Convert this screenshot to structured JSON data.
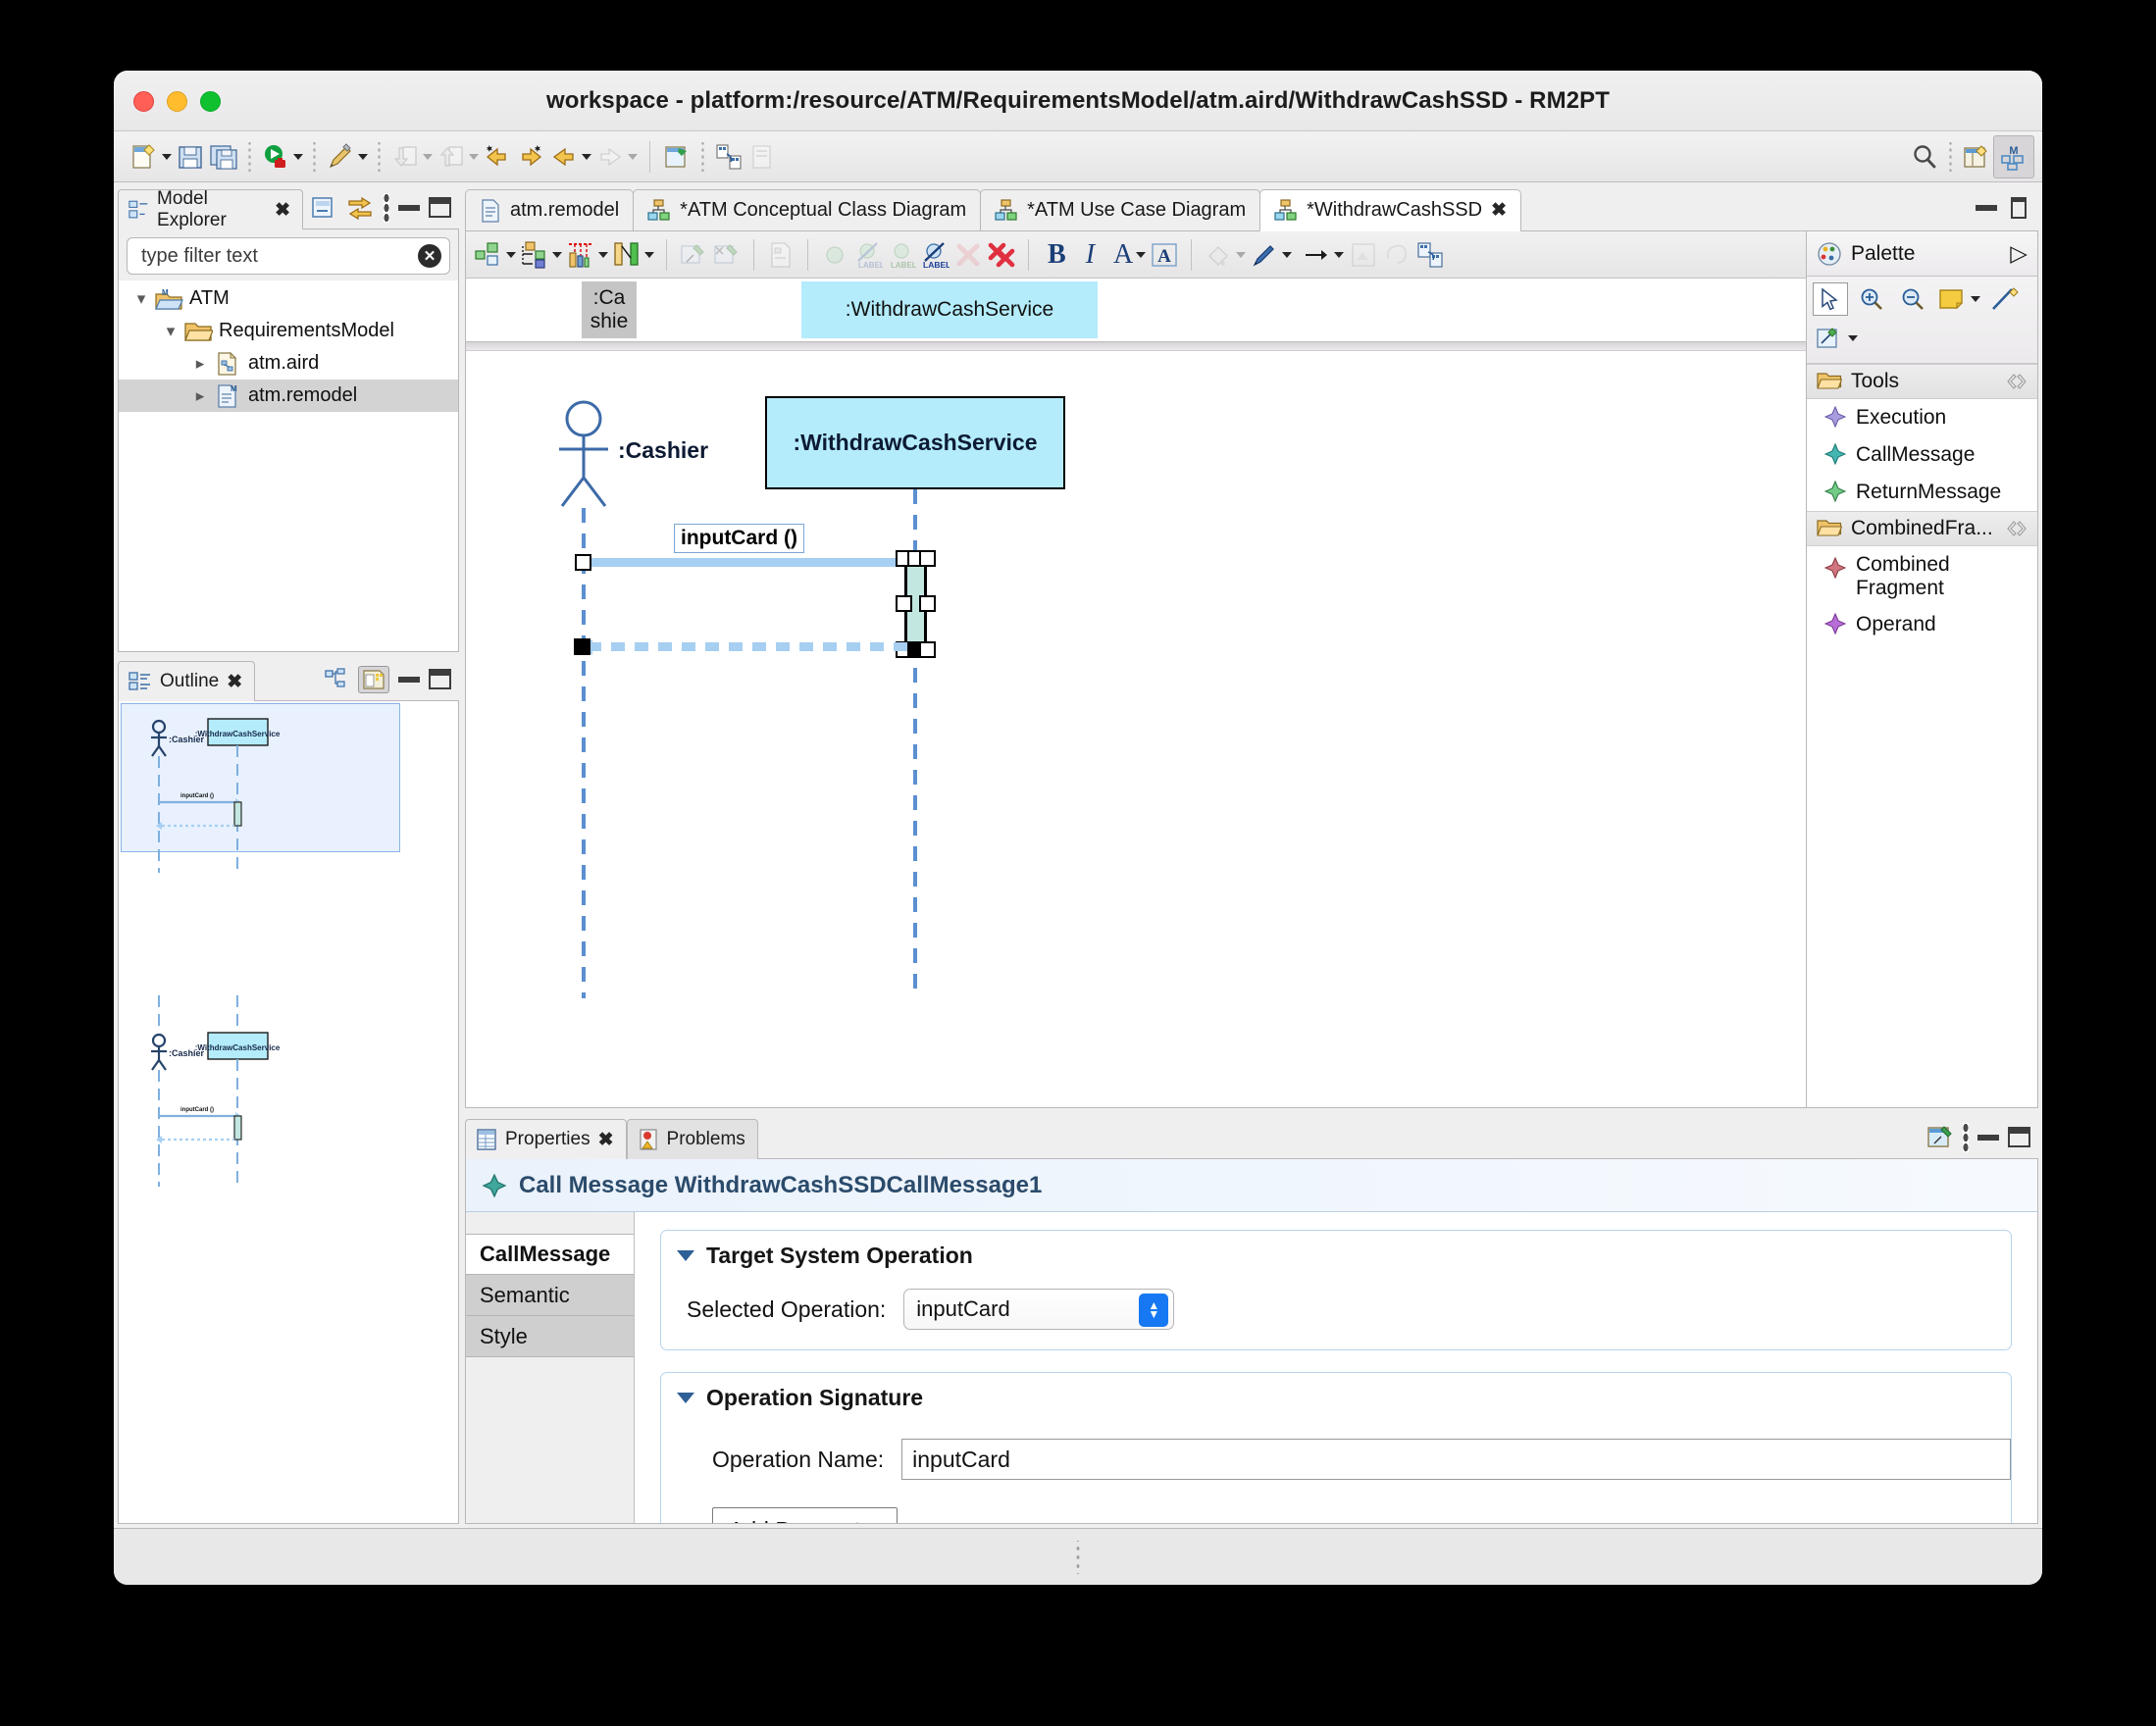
{
  "window": {
    "title": "workspace - platform:/resource/ATM/RequirementsModel/atm.aird/WithdrawCashSSD - RM2PT",
    "traffic_lights": [
      "close",
      "minimize",
      "zoom"
    ]
  },
  "main_toolbar": {
    "items": [
      {
        "name": "new-wizard",
        "icon": "new-file-icon",
        "has_menu": true,
        "enabled": true
      },
      {
        "name": "save",
        "icon": "save-icon",
        "has_menu": false,
        "enabled": true
      },
      {
        "name": "save-all",
        "icon": "save-all-icon",
        "has_menu": false,
        "enabled": true
      },
      {
        "name": "run",
        "icon": "run-icon",
        "has_menu": true,
        "enabled": true
      },
      {
        "name": "quick-access-pen",
        "icon": "pen-icon",
        "has_menu": true,
        "enabled": true
      },
      {
        "name": "import",
        "icon": "import-icon",
        "has_menu": true,
        "enabled": false
      },
      {
        "name": "export",
        "icon": "export-icon",
        "has_menu": true,
        "enabled": false
      },
      {
        "name": "back-star",
        "icon": "back-star-icon",
        "has_menu": false,
        "enabled": true
      },
      {
        "name": "forward-star",
        "icon": "forward-star-icon",
        "has_menu": false,
        "enabled": true
      },
      {
        "name": "back",
        "icon": "back-arrow-icon",
        "has_menu": true,
        "enabled": true
      },
      {
        "name": "forward",
        "icon": "forward-arrow-icon",
        "has_menu": true,
        "enabled": false
      },
      {
        "name": "open-representation",
        "icon": "open-diagram-icon",
        "has_menu": false,
        "enabled": true
      },
      {
        "name": "generate",
        "icon": "generate-icon",
        "has_menu": false,
        "enabled": true
      },
      {
        "name": "validate",
        "icon": "validate-icon",
        "has_menu": false,
        "enabled": false
      }
    ],
    "right_items": [
      {
        "name": "search",
        "icon": "search-icon"
      },
      {
        "name": "open-perspective",
        "icon": "open-perspective-icon"
      },
      {
        "name": "perspective-rm2pt",
        "icon": "perspective-m-icon",
        "active": true
      }
    ]
  },
  "model_explorer": {
    "tab_label": "Model Explorer",
    "tab_icon": "model-explorer-icon",
    "toolbar": [
      {
        "name": "collapse-all",
        "icon": "collapse-all-icon"
      },
      {
        "name": "link-with-editor",
        "icon": "link-editor-icon"
      },
      {
        "name": "view-menu",
        "icon": "view-menu-icon"
      },
      {
        "name": "minimize",
        "icon": "minimize-icon"
      },
      {
        "name": "maximize",
        "icon": "maximize-icon"
      }
    ],
    "filter": {
      "value": "",
      "placeholder": "type filter text",
      "clear_icon": "clear-icon"
    },
    "tree": [
      {
        "label": "ATM",
        "icon": "project-icon",
        "depth": 0,
        "expanded": true,
        "selected": false
      },
      {
        "label": "RequirementsModel",
        "icon": "folder-icon",
        "depth": 1,
        "expanded": true,
        "selected": false
      },
      {
        "label": "atm.aird",
        "icon": "aird-file-icon",
        "depth": 2,
        "expanded": false,
        "selected": false
      },
      {
        "label": "atm.remodel",
        "icon": "remodel-file-icon",
        "depth": 2,
        "expanded": false,
        "selected": true
      }
    ]
  },
  "outline": {
    "tab_label": "Outline",
    "tab_icon": "outline-icon",
    "toolbar": [
      {
        "name": "tree-outline-mode",
        "icon": "tree-outline-icon"
      },
      {
        "name": "overview-mode",
        "icon": "overview-icon",
        "active": true
      },
      {
        "name": "minimize",
        "icon": "minimize-icon"
      },
      {
        "name": "maximize",
        "icon": "maximize-icon"
      }
    ],
    "thumbnails": [
      {
        "actor": ":Cashier",
        "object": ":WithdrawCashService",
        "message": "inputCard ()"
      },
      {
        "actor": ":Cashier",
        "object": ":WithdrawCashService",
        "message": "inputCard ()"
      }
    ]
  },
  "editor": {
    "tabs": [
      {
        "label": "atm.remodel",
        "icon": "remodel-file-icon",
        "active": false,
        "dirty": false
      },
      {
        "label": "*ATM Conceptual Class Diagram",
        "icon": "diagram-icon",
        "active": false,
        "dirty": true
      },
      {
        "label": "*ATM Use Case Diagram",
        "icon": "diagram-icon",
        "active": false,
        "dirty": true
      },
      {
        "label": "*WithdrawCashSSD",
        "icon": "diagram-icon",
        "active": true,
        "dirty": true
      }
    ],
    "tab_controls": [
      {
        "name": "minimize",
        "icon": "minimize-icon"
      },
      {
        "name": "maximize",
        "icon": "maximize-icon"
      }
    ],
    "toolbar_groups": [
      [
        {
          "name": "arrange-all",
          "icon": "arrange-all-icon",
          "has_menu": true,
          "enabled": true
        },
        {
          "name": "select-elements",
          "icon": "select-elements-icon",
          "has_menu": true,
          "enabled": true
        },
        {
          "name": "ruler-grid",
          "icon": "ruler-grid-icon",
          "has_menu": true,
          "enabled": true
        },
        {
          "name": "snap-align",
          "icon": "snap-align-icon",
          "has_menu": true,
          "enabled": true
        }
      ],
      [
        {
          "name": "pin-elements",
          "icon": "pin-icon",
          "has_menu": false,
          "enabled": false
        },
        {
          "name": "unpin-elements",
          "icon": "unpin-icon",
          "has_menu": false,
          "enabled": false
        }
      ],
      [
        {
          "name": "refresh-diagram",
          "icon": "refresh-diagram-icon",
          "has_menu": false,
          "enabled": false
        }
      ],
      [
        {
          "name": "hide-element",
          "icon": "hide-element-icon",
          "has_menu": false,
          "enabled": false
        },
        {
          "name": "hide-label",
          "icon": "hide-label-icon",
          "has_menu": false,
          "enabled": false
        },
        {
          "name": "show-label",
          "icon": "show-label-icon",
          "has_menu": false,
          "enabled": false
        },
        {
          "name": "show-label-active",
          "icon": "show-label-active-icon",
          "has_menu": false,
          "enabled": true
        },
        {
          "name": "delete-element",
          "icon": "delete-element-icon",
          "has_menu": false,
          "enabled": false
        },
        {
          "name": "delete-from-model",
          "icon": "delete-model-icon",
          "has_menu": false,
          "enabled": true
        }
      ],
      [
        {
          "name": "bold",
          "icon": "bold-icon",
          "label": "B",
          "enabled": true
        },
        {
          "name": "italic",
          "icon": "italic-icon",
          "label": "I",
          "enabled": true
        },
        {
          "name": "font-color",
          "icon": "font-color-icon",
          "label": "A",
          "has_menu": true,
          "enabled": true
        },
        {
          "name": "font-dialog",
          "icon": "font-dialog-icon",
          "enabled": true
        }
      ],
      [
        {
          "name": "fill-color",
          "icon": "fill-color-icon",
          "has_menu": true,
          "enabled": false
        },
        {
          "name": "line-color",
          "icon": "line-color-icon",
          "has_menu": true,
          "enabled": true
        },
        {
          "name": "line-style",
          "icon": "line-style-icon",
          "has_menu": true,
          "enabled": true
        },
        {
          "name": "straighten",
          "icon": "straighten-icon",
          "enabled": false
        },
        {
          "name": "reset-origin",
          "icon": "reset-origin-icon",
          "enabled": false
        },
        {
          "name": "paste-layout",
          "icon": "paste-layout-icon",
          "enabled": true
        }
      ]
    ]
  },
  "diagram": {
    "frozen_header": [
      {
        "name": ":Ca\nshie",
        "line1": ":Ca",
        "line2": "shie",
        "type": "actor",
        "color": "#c6c5c6"
      },
      {
        "name": ":WithdrawCashService",
        "type": "object",
        "color": "#b4ecfb"
      }
    ],
    "actor": {
      "label": ":Cashier"
    },
    "object": {
      "label": ":WithdrawCashService",
      "fill": "#b4ecfb"
    },
    "messages": [
      {
        "name": "inputCard ()",
        "kind": "call",
        "from": ":Cashier",
        "to": ":WithdrawCashService",
        "selected": true
      },
      {
        "name": "",
        "kind": "return",
        "from": ":WithdrawCashService",
        "to": ":Cashier",
        "selected": true
      }
    ],
    "execution": {
      "selected": true,
      "fill": "#c2e7e0"
    }
  },
  "palette": {
    "title": "Palette",
    "title_icon": "palette-icon",
    "pin_icon": "palette-pin-icon",
    "tools_row1": [
      {
        "name": "select-tool",
        "icon": "arrow-cursor-icon",
        "selected": true
      },
      {
        "name": "zoom-in-tool",
        "icon": "zoom-in-icon",
        "selected": false
      },
      {
        "name": "zoom-out-tool",
        "icon": "zoom-out-icon",
        "selected": false
      },
      {
        "name": "note-tool",
        "icon": "note-icon",
        "selected": false,
        "has_menu": true
      },
      {
        "name": "note-attachment-tool",
        "icon": "note-attachment-icon",
        "selected": false
      }
    ],
    "tools_row2": [
      {
        "name": "generic-tool",
        "icon": "generic-diagram-icon",
        "selected": false,
        "has_menu": true
      }
    ],
    "sections": [
      {
        "title": "Tools",
        "section_icon": "folder-open-icon",
        "collapse_icon": "collapse-section-icon",
        "items": [
          {
            "label": "Execution",
            "icon": "execution-tool-icon",
            "color": "#9b8fd6"
          },
          {
            "label": "CallMessage",
            "icon": "callmessage-tool-icon",
            "color": "#3aada9"
          },
          {
            "label": "ReturnMessage",
            "icon": "returnmessage-tool-icon",
            "color": "#64c27b"
          }
        ]
      },
      {
        "title": "CombinedFra...",
        "section_icon": "folder-open-icon",
        "collapse_icon": "collapse-section-icon",
        "items": [
          {
            "label": "Combined Fragment",
            "icon": "combined-fragment-tool-icon",
            "color": "#c4606a"
          },
          {
            "label": "Operand",
            "icon": "operand-tool-icon",
            "color": "#a959c9"
          }
        ]
      }
    ]
  },
  "properties": {
    "tabs": [
      {
        "label": "Properties",
        "icon": "properties-icon",
        "active": true,
        "closeable": true
      },
      {
        "label": "Problems",
        "icon": "problems-icon",
        "active": false,
        "closeable": false
      }
    ],
    "toolbar": [
      {
        "name": "pin-properties",
        "icon": "pin-view-icon"
      },
      {
        "name": "view-menu",
        "icon": "view-menu-icon"
      },
      {
        "name": "minimize",
        "icon": "minimize-icon"
      },
      {
        "name": "maximize",
        "icon": "maximize-icon"
      }
    ],
    "header": {
      "icon": "callmessage-header-icon",
      "title": "Call Message WithdrawCashSSDCallMessage1"
    },
    "side_tabs": [
      {
        "label": "CallMessage",
        "active": true
      },
      {
        "label": "Semantic",
        "active": false
      },
      {
        "label": "Style",
        "active": false
      }
    ],
    "groups": [
      {
        "title": "Target System Operation",
        "expanded": true,
        "fields": [
          {
            "type": "combo",
            "label": "Selected Operation:",
            "value": "inputCard",
            "name": "selected-operation-combo"
          }
        ]
      },
      {
        "title": "Operation Signature",
        "expanded": true,
        "fields": [
          {
            "type": "text",
            "label": "Operation Name:",
            "value": "inputCard",
            "name": "operation-name-input"
          },
          {
            "type": "button",
            "label": "Add Parameter",
            "name": "add-parameter-button"
          }
        ]
      }
    ]
  },
  "colors": {
    "accent_blue": "#1678f2",
    "object_fill": "#b4ecfb",
    "execution_fill": "#c2e7e0",
    "message_blue": "#a6cff2",
    "selection_gray": "#d4d3d4",
    "header_blue": "#2b4b6b"
  }
}
